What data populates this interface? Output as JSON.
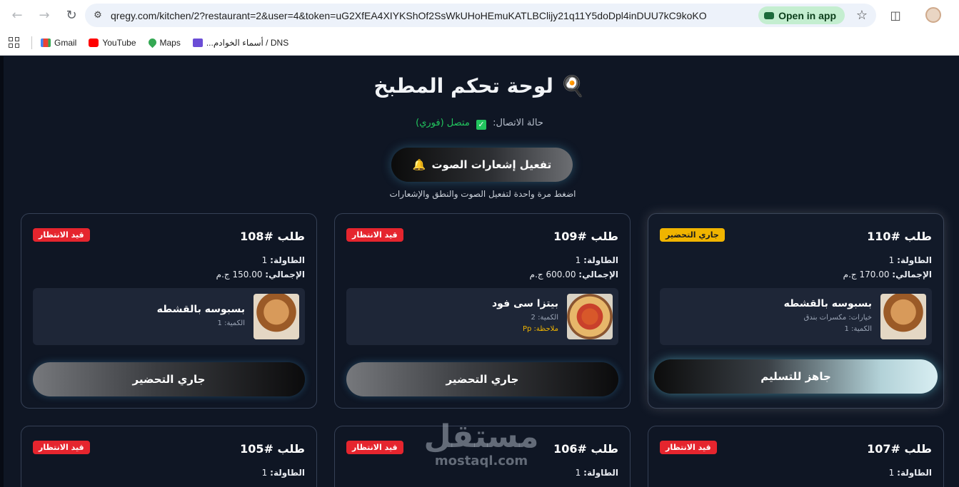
{
  "browser": {
    "url": "qregy.com/kitchen/2?restaurant=2&user=4&token=uG2XfEA4XIYKShOf2SsWkUHoHEmuKATLBClijy21q11Y5doDpl4inDUU7kC9koKO",
    "open_in_app": "Open in app",
    "bookmarks": [
      "Gmail",
      "YouTube",
      "Maps",
      "DNS / أسماء الخوادم..."
    ]
  },
  "page": {
    "title": "لوحة تحكم المطبخ",
    "title_icon": "🍳",
    "connection_label": "حالة الاتصال:",
    "connection_value": "متصل (فوري)",
    "sound_button": "تفعيل إشعارات الصوت",
    "sound_icon": "🔔",
    "sound_hint": "اضغط مرة واحدة لتفعيل الصوت والنطق والإشعارات"
  },
  "labels": {
    "table": "الطاولة:",
    "total": "الإجمالي:",
    "qty": "الكمية:",
    "options": "خيارات:",
    "note": "ملاحظة:"
  },
  "orders": [
    {
      "number": "طلب #110",
      "status": "جاري التحضير",
      "table": "1",
      "total": "170.00 ج.م",
      "item_name": "بسبوسه بالقشطه",
      "item_options": "مكسرات بندق",
      "item_qty": "1",
      "action": "جاهز للتسليم"
    },
    {
      "number": "طلب #109",
      "status": "قيد الانتظار",
      "table": "1",
      "total": "600.00 ج.م",
      "item_name": "بيتزا سى فود",
      "item_qty": "2",
      "item_note": "Pp",
      "action": "جاري التحضير"
    },
    {
      "number": "طلب #108",
      "status": "قيد الانتظار",
      "table": "1",
      "total": "150.00 ج.م",
      "item_name": "بسبوسه بالقشطه",
      "item_qty": "1",
      "action": "جاري التحضير"
    },
    {
      "number": "طلب #107",
      "status": "قيد الانتظار",
      "table": "1"
    },
    {
      "number": "طلب #106",
      "status": "قيد الانتظار",
      "table": "1"
    },
    {
      "number": "طلب #105",
      "status": "قيد الانتظار",
      "table": "1"
    }
  ],
  "watermark": {
    "ar": "مستقل",
    "en": "mostaql.com"
  }
}
